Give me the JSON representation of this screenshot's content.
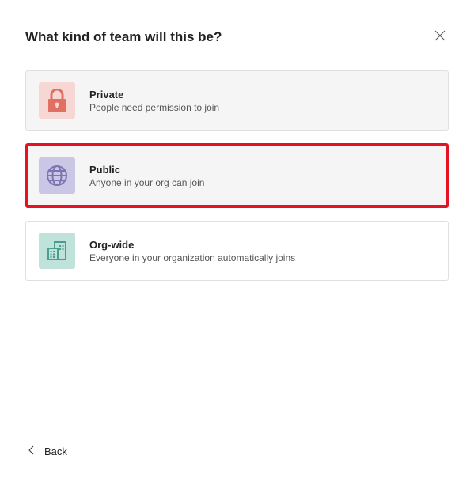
{
  "header": {
    "title": "What kind of team will this be?"
  },
  "options": {
    "private": {
      "title": "Private",
      "desc": "People need permission to join"
    },
    "public": {
      "title": "Public",
      "desc": "Anyone in your org can join"
    },
    "orgwide": {
      "title": "Org-wide",
      "desc": "Everyone in your organization automatically joins"
    }
  },
  "footer": {
    "back": "Back"
  }
}
